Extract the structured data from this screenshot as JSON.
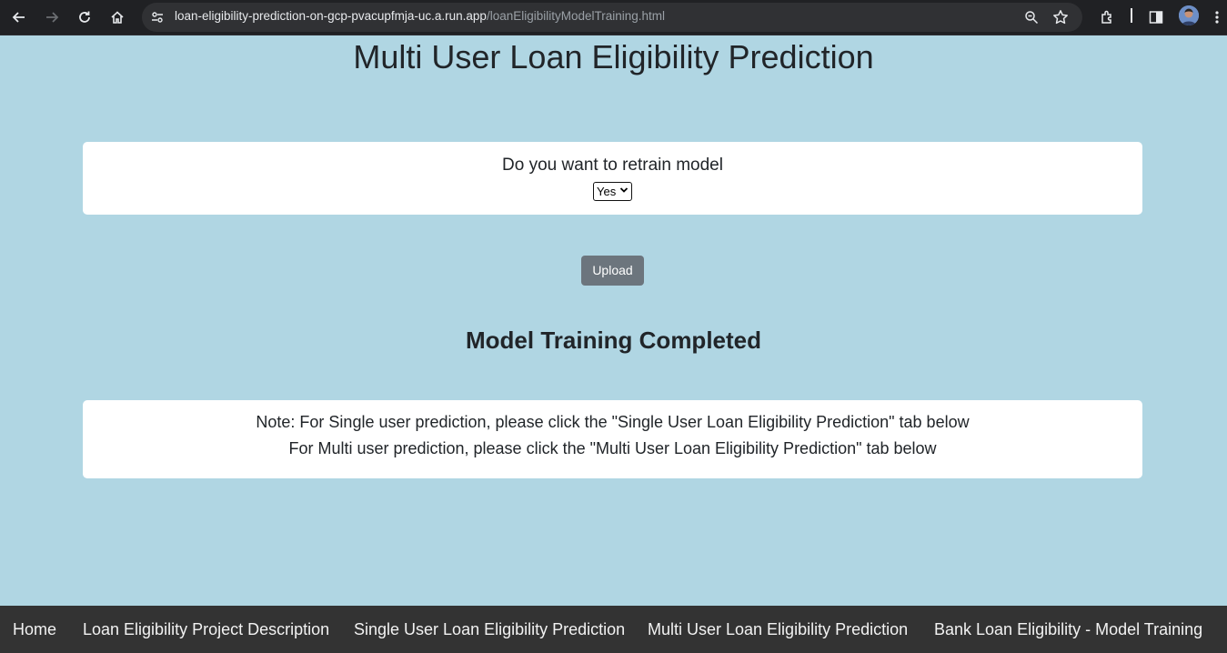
{
  "browser": {
    "url_host": "loan-eligibility-prediction-on-gcp-pvacupfmja-uc.a.run.app",
    "url_path": "/loanEligibilityModelTraining.html"
  },
  "page": {
    "title": "Multi User Loan Eligibility Prediction",
    "retrain": {
      "question": "Do you want to retrain model",
      "selected": "Yes"
    },
    "upload_label": "Upload",
    "status": "Model Training Completed",
    "note": {
      "line1": "Note: For Single user prediction, please click the \"Single User Loan Eligibility Prediction\" tab below",
      "line2": "For Multi user prediction, please click the \"Multi User Loan Eligibility Prediction\" tab below"
    }
  },
  "footer_nav": [
    "Home",
    "Loan Eligibility Project Description",
    "Single User Loan Eligibility Prediction",
    "Multi User Loan Eligibility Prediction",
    "Bank Loan Eligibility - Model Training"
  ]
}
